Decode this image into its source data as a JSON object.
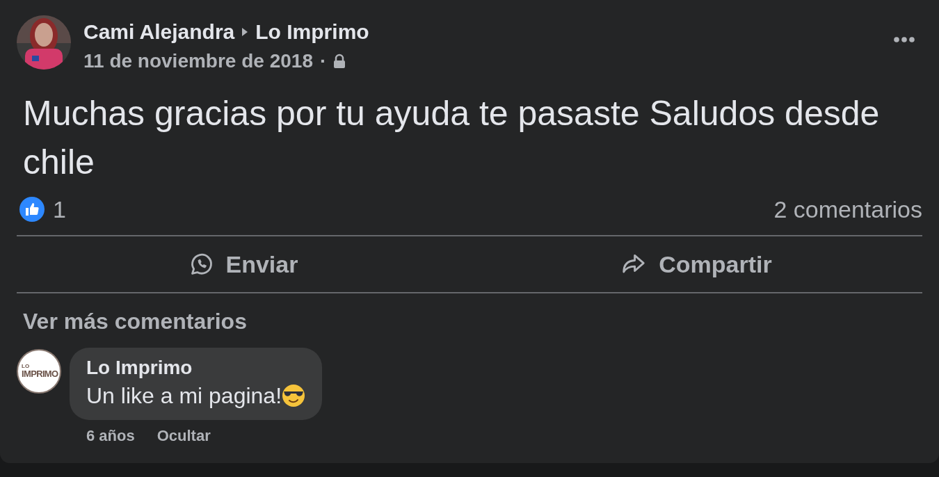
{
  "post": {
    "author": "Cami Alejandra",
    "target": "Lo Imprimo",
    "date": "11 de noviembre de 2018",
    "separator": "·",
    "text": "Muchas gracias por tu ayuda te pasaste Saludos desde chile",
    "reactions": {
      "count": "1"
    },
    "comments_count": "2 comentarios",
    "actions": [
      {
        "kind": "send",
        "label": "Enviar"
      },
      {
        "kind": "share",
        "label": "Compartir"
      }
    ]
  },
  "comments_section": {
    "more_link": "Ver más comentarios",
    "comments": [
      {
        "author": "Lo Imprimo",
        "avatar_logo": {
          "small": "LO",
          "big": "IMPRIMO"
        },
        "text": "Un like a mi pagina!",
        "time": "6 años",
        "hide_link": "Ocultar"
      }
    ]
  }
}
